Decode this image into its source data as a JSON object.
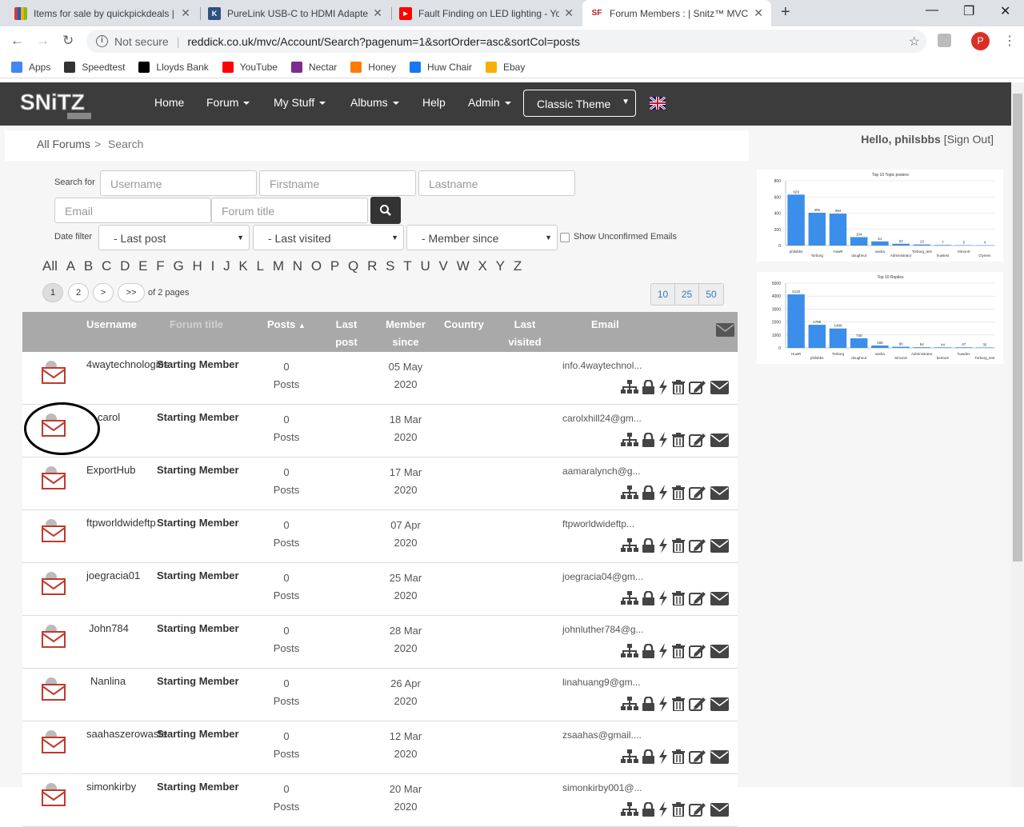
{
  "browser": {
    "tabs": [
      {
        "title": "Items for sale by quickpickdeals |",
        "favicon": "shopping-bag-icon",
        "color": "#e53238"
      },
      {
        "title": "PureLink USB-C to HDMI Adapte",
        "favicon": "k-icon",
        "color": "#2c5282"
      },
      {
        "title": "Fault Finding on LED lighting - Yo",
        "favicon": "youtube-icon",
        "color": "#ff0000"
      },
      {
        "title": "Forum Members : | Snitz™ MVC F",
        "favicon": "sf-icon",
        "color": "#b71c1c"
      }
    ],
    "address": {
      "security": "Not secure",
      "url": "reddick.co.uk/mvc/Account/Search?pagenum=1&sortOrder=asc&sortCol=posts"
    },
    "avatar_letter": "P",
    "bookmarks": [
      {
        "label": "Apps",
        "icon": "apps-grid-icon",
        "color": "#4285f4"
      },
      {
        "label": "Speedtest",
        "icon": "speedometer-icon",
        "color": "#333333"
      },
      {
        "label": "Lloyds Bank",
        "icon": "horse-icon",
        "color": "#000000"
      },
      {
        "label": "YouTube",
        "icon": "youtube-icon",
        "color": "#ff0000"
      },
      {
        "label": "Nectar",
        "icon": "nectar-icon",
        "color": "#7b2d8e"
      },
      {
        "label": "Honey",
        "icon": "honey-icon",
        "color": "#ff7a00"
      },
      {
        "label": "Huw Chair",
        "icon": "facebook-icon",
        "color": "#1877f2"
      },
      {
        "label": "Ebay",
        "icon": "bag-icon",
        "color": "#f5af02"
      }
    ]
  },
  "site": {
    "logo": "SNiTZ",
    "nav": [
      {
        "label": "Home",
        "dropdown": false
      },
      {
        "label": "Forum",
        "dropdown": true
      },
      {
        "label": "My Stuff",
        "dropdown": true
      },
      {
        "label": "Albums",
        "dropdown": true
      },
      {
        "label": "Help",
        "dropdown": false
      },
      {
        "label": "Admin",
        "dropdown": true
      }
    ],
    "theme": "Classic Theme"
  },
  "breadcrumb": {
    "root": "All Forums",
    "sep": ">",
    "current": "Search"
  },
  "user": {
    "greeting": "Hello, philsbbs",
    "signout": "[Sign Out]"
  },
  "search": {
    "label": "Search for",
    "username_ph": "Username",
    "firstname_ph": "Firstname",
    "lastname_ph": "Lastname",
    "email_ph": "Email",
    "forumtitle_ph": "Forum title",
    "date_filter_label": "Date filter",
    "last_post": "- Last post",
    "last_visited": "- Last visited",
    "member_since": "- Member since",
    "unconfirmed": "Show Unconfirmed Emails"
  },
  "alphabet": [
    "All",
    "A",
    "B",
    "C",
    "D",
    "E",
    "F",
    "G",
    "H",
    "I",
    "J",
    "K",
    "L",
    "M",
    "N",
    "O",
    "P",
    "Q",
    "R",
    "S",
    "T",
    "U",
    "V",
    "W",
    "X",
    "Y",
    "Z"
  ],
  "pager": {
    "pages": [
      "1",
      "2",
      ">",
      ">>"
    ],
    "of_pages": "of 2 pages",
    "sizes": [
      "10",
      "25",
      "50"
    ]
  },
  "table": {
    "headers": {
      "username": "Username",
      "forum_title": "Forum title",
      "posts": "Posts",
      "last_post_1": "Last",
      "last_post_2": "post",
      "member_since_1": "Member",
      "member_since_2": "since",
      "country": "Country",
      "last_visited_1": "Last",
      "last_visited_2": "visited",
      "email": "Email"
    },
    "rows": [
      {
        "username": "4waytechnologies",
        "title": "Starting Member",
        "posts": "0",
        "posts_label": "Posts",
        "since_1": "05 May",
        "since_2": "2020",
        "email": "info.4waytechnol..."
      },
      {
        "username": "carol",
        "title": "Starting Member",
        "posts": "0",
        "posts_label": "Posts",
        "since_1": "18 Mar",
        "since_2": "2020",
        "email": "carolxhill24@gm..."
      },
      {
        "username": "ExportHub",
        "title": "Starting Member",
        "posts": "0",
        "posts_label": "Posts",
        "since_1": "17 Mar",
        "since_2": "2020",
        "email": "aamaralynch@g..."
      },
      {
        "username": "ftpworldwideftp",
        "title": "Starting Member",
        "posts": "0",
        "posts_label": "Posts",
        "since_1": "07 Apr",
        "since_2": "2020",
        "email": "ftpworldwideftp..."
      },
      {
        "username": "joegracia01",
        "title": "Starting Member",
        "posts": "0",
        "posts_label": "Posts",
        "since_1": "25 Mar",
        "since_2": "2020",
        "email": "joegracia04@gm..."
      },
      {
        "username": "John784",
        "title": "Starting Member",
        "posts": "0",
        "posts_label": "Posts",
        "since_1": "28 Mar",
        "since_2": "2020",
        "email": "johnluther784@g..."
      },
      {
        "username": "Nanlina",
        "title": "Starting Member",
        "posts": "0",
        "posts_label": "Posts",
        "since_1": "26 Apr",
        "since_2": "2020",
        "email": "linahuang9@gm..."
      },
      {
        "username": "saahaszerowaste",
        "title": "Starting Member",
        "posts": "0",
        "posts_label": "Posts",
        "since_1": "12 Mar",
        "since_2": "2020",
        "email": "zsaahas@gmail...."
      },
      {
        "username": "simonkirby",
        "title": "Starting Member",
        "posts": "0",
        "posts_label": "Posts",
        "since_1": "20 Mar",
        "since_2": "2020",
        "email": "simonkirby001@..."
      }
    ]
  },
  "chart_data": [
    {
      "type": "bar",
      "title": "Top 10 Topic posters",
      "categories": [
        "philsbbs",
        "Torborg",
        "HuwR",
        "doughnut",
        "sasha",
        "Administrator",
        "Torborg_test",
        "huwtest",
        "SimonS",
        "Clymen"
      ],
      "values": [
        629,
        405,
        394,
        104,
        51,
        22,
        13,
        7,
        5,
        4
      ],
      "ylim": [
        0,
        800
      ],
      "yticks": [
        0,
        200,
        400,
        600,
        800
      ],
      "color": "#3b8eea"
    },
    {
      "type": "bar",
      "title": "Top 10 Replies",
      "categories": [
        "HuwR",
        "philsbbs",
        "Torborg",
        "doughnut",
        "sasha",
        "SimonS",
        "Administrator",
        "bertram",
        "huwdev",
        "Torborg_test"
      ],
      "values": [
        4132,
        1785,
        1499,
        740,
        188,
        90,
        54,
        44,
        47,
        35
      ],
      "ylim": [
        0,
        5000
      ],
      "yticks": [
        0,
        1000,
        2000,
        3000,
        4000,
        5000
      ],
      "color": "#3b8eea"
    }
  ]
}
